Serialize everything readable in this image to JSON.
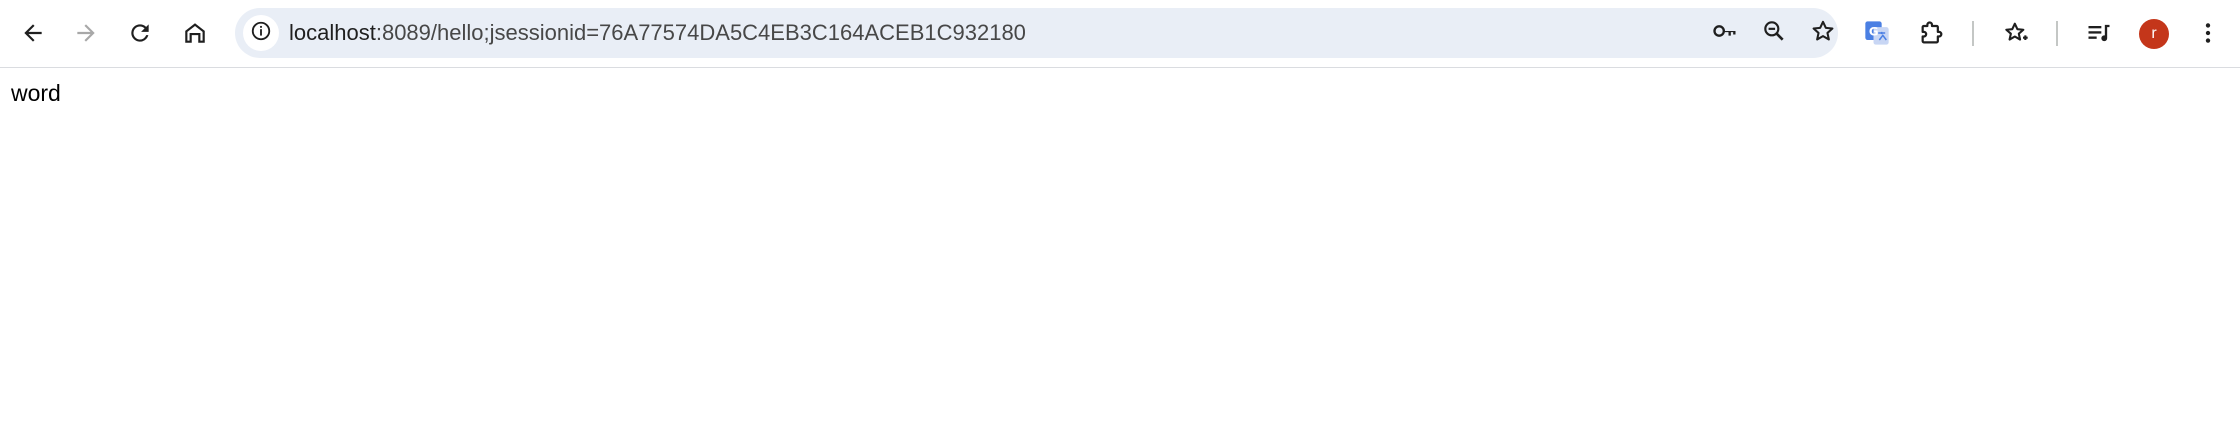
{
  "browser": {
    "nav": {
      "back_icon": "arrow-left-icon",
      "forward_icon": "arrow-right-icon",
      "reload_icon": "reload-icon",
      "home_icon": "home-icon"
    },
    "omnibox": {
      "site_info_icon": "info-circle-icon",
      "url_host": "localhost",
      "url_rest": ":8089/hello;jsessionid=76A77574DA5C4EB3C164ACEB1C932180",
      "right_icons": [
        "key-icon",
        "zoom-out-icon",
        "star-icon"
      ]
    },
    "extensions": [
      "google-translate-icon",
      "puzzle-icon"
    ],
    "reading_list_icon": "bookmark-star-icon",
    "media_icon": "media-control-icon",
    "profile": {
      "initial": "r",
      "color": "#c4361a"
    },
    "menu_icon": "kebab-menu-icon"
  },
  "page": {
    "body_text": "word"
  },
  "colors": {
    "omnibox_bg": "#e9eef6",
    "icon_color": "#474747",
    "text_color": "#1f1f1f"
  }
}
